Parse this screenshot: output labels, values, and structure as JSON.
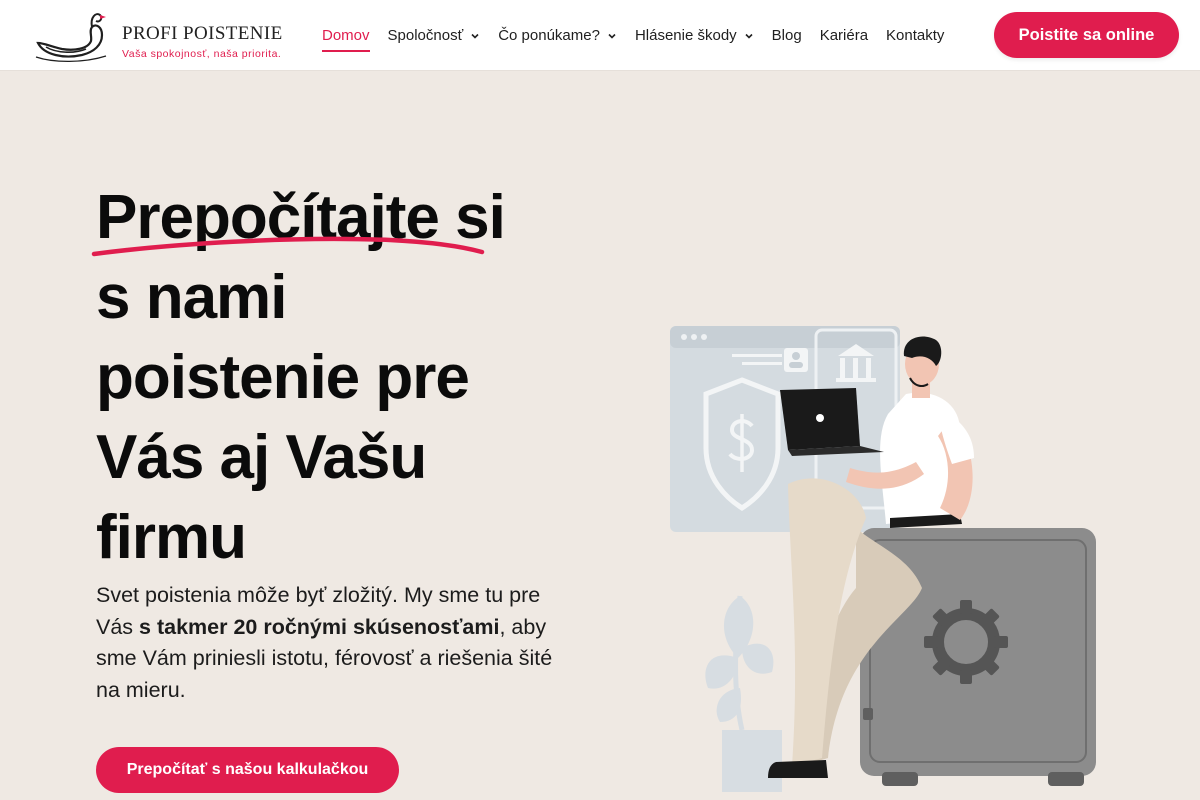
{
  "brand": {
    "name": "PROFI POISTENIE",
    "tagline": "Vaša spokojnosť, naša priorita.",
    "accent": "#e01d4e",
    "background": "#efe9e3"
  },
  "nav": {
    "items": [
      {
        "label": "Domov",
        "active": true,
        "dropdown": false
      },
      {
        "label": "Spoločnosť",
        "active": false,
        "dropdown": true
      },
      {
        "label": "Čo ponúkame?",
        "active": false,
        "dropdown": true
      },
      {
        "label": "Hlásenie škody",
        "active": false,
        "dropdown": true
      },
      {
        "label": "Blog",
        "active": false,
        "dropdown": false
      },
      {
        "label": "Kariéra",
        "active": false,
        "dropdown": false
      },
      {
        "label": "Kontakty",
        "active": false,
        "dropdown": false
      }
    ],
    "cta_label": "Poistite sa online"
  },
  "hero": {
    "title_highlight": "Prepočítajte",
    "title_rest_1": " si",
    "title_line_2": "s nami",
    "title_line_3": "poistenie pre",
    "title_line_4": "Vás aj Vašu",
    "title_line_5": "firmu",
    "text_part_1": "Svet poistenia môže byť zložitý. My sme tu pre Vás ",
    "text_bold": "s takmer 20 ročnými skúsenosťami",
    "text_part_2": ", aby sme Vám priniesli istotu, férovosť a riešenia šité na mieru.",
    "cta_label": "Prepočítať s našou kalkulačkou"
  },
  "illustration": {
    "icons": [
      "swan-logo-icon",
      "shield-dollar-icon",
      "bank-icon",
      "id-card-icon",
      "gear-icon",
      "laptop-icon",
      "plant-icon",
      "safe-icon"
    ]
  }
}
